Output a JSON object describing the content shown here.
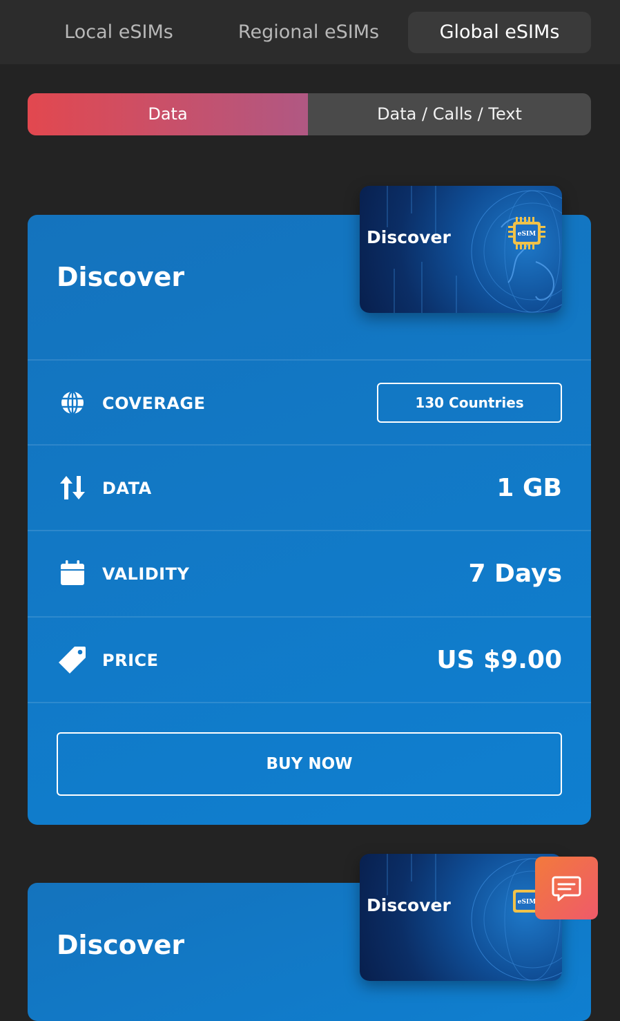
{
  "tabs": [
    {
      "label": "Local eSIMs",
      "active": false
    },
    {
      "label": "Regional eSIMs",
      "active": false
    },
    {
      "label": "Global eSIMs",
      "active": true
    }
  ],
  "segment": {
    "data_label": "Data",
    "data_calls_text_label": "Data / Calls / Text"
  },
  "plans": [
    {
      "title": "Discover",
      "image_label": "Discover",
      "image_chip_text": "eSIM",
      "coverage_label": "COVERAGE",
      "coverage_value": "130 Countries",
      "data_label": "DATA",
      "data_value": "1 GB",
      "validity_label": "VALIDITY",
      "validity_value": "7 Days",
      "price_label": "PRICE",
      "price_value": "US $9.00",
      "buy_label": "BUY NOW"
    },
    {
      "title": "Discover",
      "image_label": "Discover",
      "image_chip_text": "eSIM"
    }
  ],
  "colors": {
    "accent_start": "#e2484f",
    "accent_end": "#b05883",
    "card": "#1176c6",
    "chat_start": "#f27a3c",
    "chat_end": "#ef5a6a"
  },
  "icons": [
    "globe-icon",
    "data-transfer-icon",
    "calendar-icon",
    "price-tag-icon",
    "chat-icon",
    "esim-chip-icon"
  ]
}
